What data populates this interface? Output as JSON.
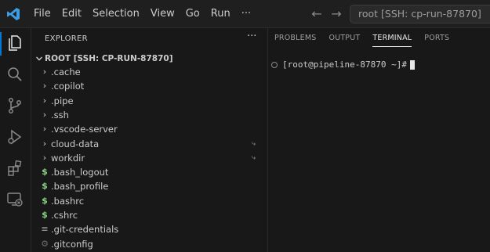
{
  "titlebar": {
    "menu": [
      "File",
      "Edit",
      "Selection",
      "View",
      "Go",
      "Run",
      "···"
    ],
    "command_center": "root [SSH: cp-run-87870]"
  },
  "activitybar": {
    "items": [
      "explorer-icon",
      "search-icon",
      "source-control-icon",
      "run-debug-icon",
      "extensions-icon",
      "remote-explorer-icon"
    ]
  },
  "sidebar": {
    "header": "EXPLORER",
    "more": "···",
    "root": "ROOT [SSH: CP-RUN-87870]",
    "items": [
      {
        "label": ".cache",
        "icon": "chevron-right-icon",
        "glyph": "›"
      },
      {
        "label": ".copilot",
        "icon": "chevron-right-icon",
        "glyph": "›"
      },
      {
        "label": ".pipe",
        "icon": "chevron-right-icon",
        "glyph": "›"
      },
      {
        "label": ".ssh",
        "icon": "chevron-right-icon",
        "glyph": "›"
      },
      {
        "label": ".vscode-server",
        "icon": "chevron-right-icon",
        "glyph": "›"
      },
      {
        "label": "cloud-data",
        "icon": "chevron-right-icon",
        "glyph": "›",
        "badge": "⤷"
      },
      {
        "label": "workdir",
        "icon": "chevron-right-icon",
        "glyph": "›",
        "badge": "⤷"
      },
      {
        "label": ".bash_logout",
        "icon": "shell-file-icon",
        "glyph": "$"
      },
      {
        "label": ".bash_profile",
        "icon": "shell-file-icon",
        "glyph": "$"
      },
      {
        "label": ".bashrc",
        "icon": "shell-file-icon",
        "glyph": "$"
      },
      {
        "label": ".cshrc",
        "icon": "shell-file-icon",
        "glyph": "$"
      },
      {
        "label": ".git-credentials",
        "icon": "text-file-icon",
        "glyph": "≡"
      },
      {
        "label": ".gitconfig",
        "icon": "gear-file-icon",
        "glyph": "⚙"
      }
    ]
  },
  "panel": {
    "tabs": [
      "PROBLEMS",
      "OUTPUT",
      "TERMINAL",
      "PORTS"
    ],
    "active_tab": "TERMINAL",
    "prompt": "[root@pipeline-87870 ~]#"
  },
  "colors": {
    "accent": "#0078d4",
    "shell_icon": "#89d185",
    "background": "#1f1f1f"
  }
}
